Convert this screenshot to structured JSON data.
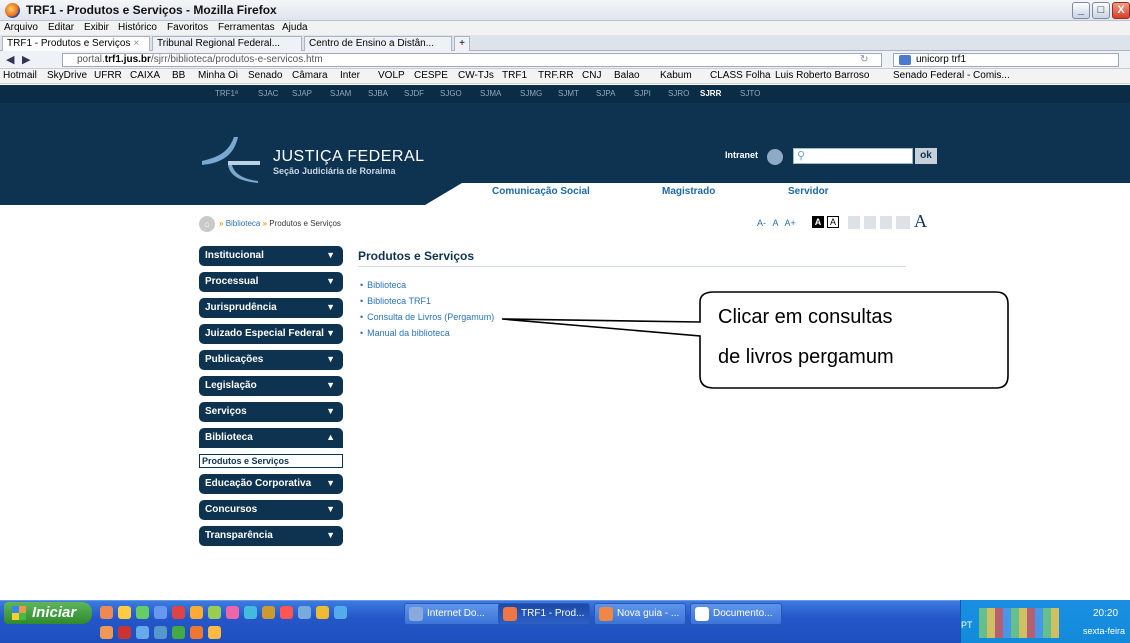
{
  "window": {
    "title": "TRF1 - Produtos e Serviços - Mozilla Firefox",
    "controls": [
      "_",
      "□",
      "X"
    ]
  },
  "menubar": [
    "Arquivo",
    "Editar",
    "Exibir",
    "Histórico",
    "Favoritos",
    "Ferramentas",
    "Ajuda"
  ],
  "tabs": [
    {
      "label": "TRF1 - Produtos e Serviços"
    },
    {
      "label": "Tribunal Regional Federal..."
    },
    {
      "label": "Centro de Ensino a Distân..."
    }
  ],
  "new_tab": "+",
  "navbar": {
    "url_domain": "portal.",
    "url_bold": "trf1.jus.br",
    "url_path": "/sjrr/biblioteca/produtos-e-servicos.htm",
    "search_value": "unicorp trf1"
  },
  "bookmarks": [
    "Hotmail",
    "SkyDrive",
    "UFRR",
    "CAIXA",
    "BB",
    "Minha Oi",
    "Senado",
    "Câmara",
    "Inter",
    "VOLP",
    "CESPE",
    "CW-TJs",
    "TRF1",
    "TRF.RR",
    "CNJ",
    "Balao",
    "Kabum",
    "CLASS Folha",
    "Luis Roberto Barroso",
    "Senado Federal - Comis..."
  ],
  "site": {
    "top_links": [
      "TRF1ª",
      "SJAC",
      "SJAP",
      "SJAM",
      "SJBA",
      "SJDF",
      "SJGO",
      "SJMA",
      "SJMG",
      "SJMT",
      "SJPA",
      "SJPI",
      "SJRO",
      "SJRR",
      "SJTO"
    ],
    "logo_title": "JUSTIÇA FEDERAL",
    "logo_subtitle": "Seção Judiciária de Roraima",
    "intranet": "Intranet",
    "search_button": "ok",
    "main_nav": [
      "Comunicação Social",
      "Magistrado",
      "Servidor"
    ],
    "breadcrumb": [
      "Biblioteca",
      "Produtos e Serviços"
    ],
    "font_controls": [
      "A-",
      "A",
      "A+",
      "A",
      "A"
    ],
    "sidebar": [
      {
        "label": "Institucional",
        "arrow": "▼"
      },
      {
        "label": "Processual",
        "arrow": "▼"
      },
      {
        "label": "Jurisprudência",
        "arrow": "▼"
      },
      {
        "label": "Juizado Especial Federal",
        "arrow": "▼"
      },
      {
        "label": "Publicações",
        "arrow": "▼"
      },
      {
        "label": "Legislação",
        "arrow": "▼"
      },
      {
        "label": "Serviços",
        "arrow": "▼"
      },
      {
        "label": "Biblioteca",
        "arrow": "▲"
      },
      {
        "label": "Educação Corporativa",
        "arrow": "▼"
      },
      {
        "label": "Concursos",
        "arrow": "▼"
      },
      {
        "label": "Transparência",
        "arrow": "▼"
      }
    ],
    "sidebar_sub": "Produtos e Serviços",
    "content_title": "Produtos e Serviços",
    "content_links": [
      "Biblioteca",
      "Biblioteca TRF1",
      "Consulta de Livros (Pergamum)",
      "Manual da biblioteca"
    ]
  },
  "callout": {
    "line1": "Clicar em consultas",
    "line2": "de livros pergamum"
  },
  "taskbar": {
    "start": "Iniciar",
    "items": [
      "Internet Do...",
      "TRF1 - Prod...",
      "Nova guia - ...",
      "Documento..."
    ],
    "lang": "PT",
    "time": "20:20",
    "day": "sexta-feira"
  }
}
